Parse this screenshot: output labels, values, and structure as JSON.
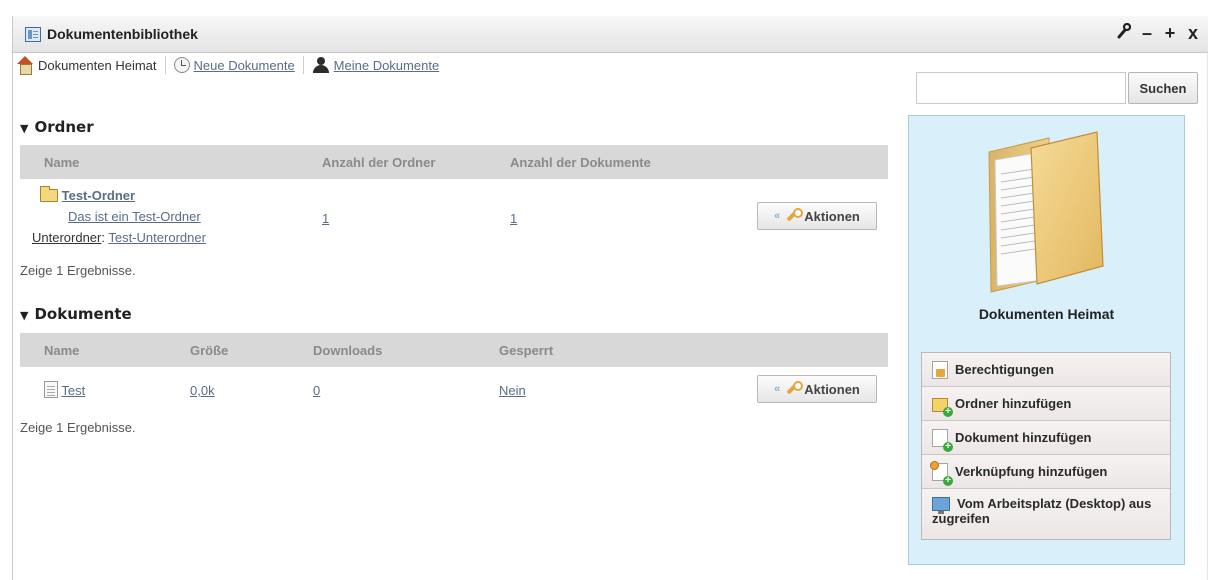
{
  "window": {
    "title": "Dokumentenbibliothek",
    "controls": [
      "wrench",
      "–",
      "+",
      "x"
    ]
  },
  "nav": {
    "home": "Dokumenten Heimat",
    "recent": "Neue Dokumente",
    "mine": "Meine Dokumente"
  },
  "folders_section": {
    "heading": "Ordner",
    "columns": [
      "Name",
      "Anzahl der Ordner",
      "Anzahl der Dokumente"
    ],
    "rows": [
      {
        "name": "Test-Ordner",
        "description": "Das ist ein Test-Ordner",
        "subfolders_label": "Unterordner",
        "subfolder": "Test-Unterordner",
        "folder_count": "1",
        "document_count": "1",
        "action": "Aktionen"
      }
    ],
    "results": "Zeige 1 Ergebnisse."
  },
  "documents_section": {
    "heading": "Dokumente",
    "columns": [
      "Name",
      "Größe",
      "Downloads",
      "Gesperrt"
    ],
    "rows": [
      {
        "name": "Test",
        "size": "0,0k",
        "downloads": "0",
        "locked": "Nein",
        "action": "Aktionen"
      }
    ],
    "results": "Zeige 1 Ergebnisse."
  },
  "search": {
    "placeholder": "",
    "button": "Suchen"
  },
  "sidebar": {
    "title": "Dokumenten Heimat",
    "menu": [
      {
        "label": "Berechtigungen",
        "icon": "permissions-icon"
      },
      {
        "label": "Ordner hinzufügen",
        "icon": "add-folder-icon"
      },
      {
        "label": "Dokument hinzufügen",
        "icon": "add-document-icon"
      },
      {
        "label": "Verknüpfung hinzufügen",
        "icon": "add-shortcut-icon"
      },
      {
        "label": "Vom Arbeitsplatz (Desktop) aus zugreifen",
        "icon": "desktop-access-icon"
      }
    ]
  },
  "colors": {
    "sidebar_bg": "#d9f0fa",
    "header_row_bg": "#d8d8d8",
    "link": "#5a6d86"
  }
}
